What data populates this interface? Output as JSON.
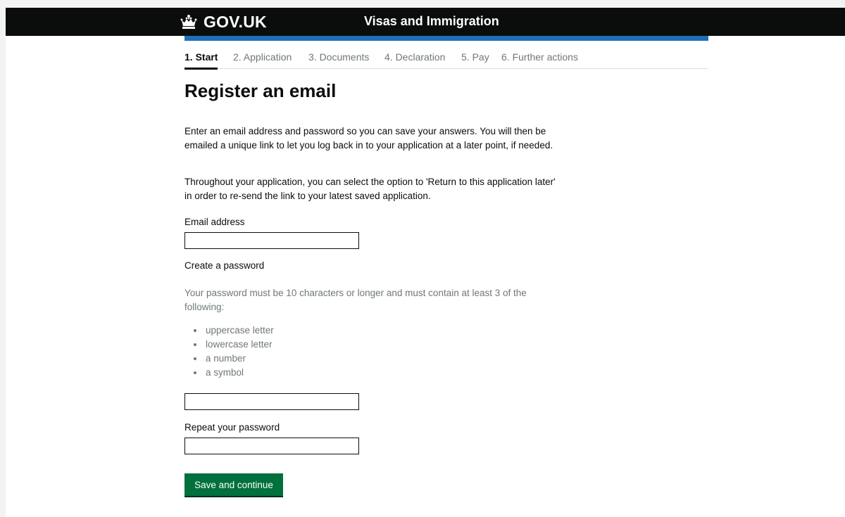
{
  "header": {
    "logo_text": "GOV.UK",
    "logo_icon": "crown-icon",
    "service_name": "Visas and Immigration",
    "colors": {
      "background": "#0b0c0c",
      "accent_bar": "#1d70b8"
    }
  },
  "steps": [
    {
      "label": "1. Start",
      "active": true
    },
    {
      "label": "2. Application",
      "active": false
    },
    {
      "label": "3. Documents",
      "active": false
    },
    {
      "label": "4. Declaration",
      "active": false
    },
    {
      "label": "5. Pay",
      "active": false
    },
    {
      "label": "6. Further actions",
      "active": false
    }
  ],
  "main": {
    "title": "Register an email",
    "intro": "Enter an email address and password so you can save your answers. You will then be emailed a unique link to let you log back in to your application at a later point, if needed.",
    "return_info": "Throughout your application, you can select the option to 'Return to this application later' in order to re-send the link to your latest saved application.",
    "email": {
      "label": "Email address",
      "value": ""
    },
    "password": {
      "label": "Create a password",
      "hint": "Your password must be 10 characters or longer and must contain at least 3 of the following:",
      "requirements": [
        "uppercase letter",
        "lowercase letter",
        "a number",
        "a symbol"
      ],
      "value": ""
    },
    "repeat_password": {
      "label": "Repeat your password",
      "value": ""
    },
    "submit_label": "Save and continue",
    "button_color": "#00703c"
  }
}
